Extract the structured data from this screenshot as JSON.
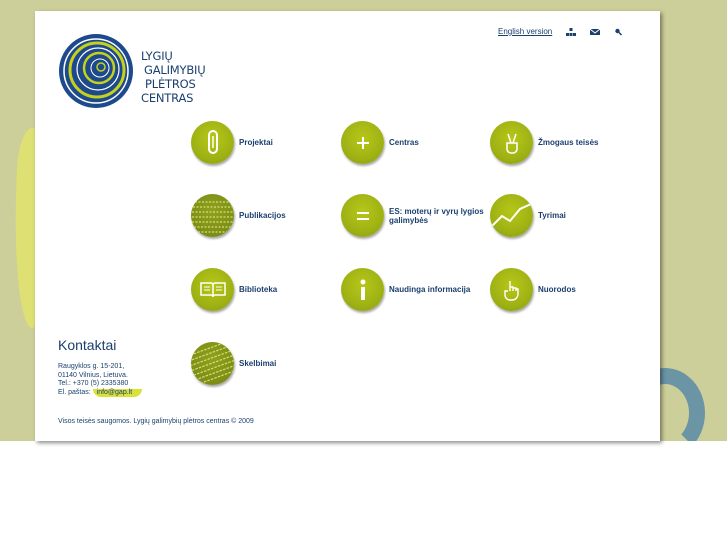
{
  "logo": {
    "lines": [
      "LYGIŲ",
      "GALIMYBIŲ",
      "PLĖTROS",
      "CENTRAS"
    ]
  },
  "topnav": {
    "english_link": "English version",
    "icons": [
      "sitemap-icon",
      "mail-icon",
      "search-icon"
    ]
  },
  "tiles": [
    {
      "label": "Projektai",
      "icon": "pencil-icon"
    },
    {
      "label": "Centras",
      "icon": "plus-icon"
    },
    {
      "label": "Žmogaus teisės",
      "icon": "victory-hand-icon"
    },
    {
      "label": "Publikacijos",
      "icon": "text-texture-icon"
    },
    {
      "label": "ES: moterų ir vyrų lygios galimybės",
      "icon": "equals-icon"
    },
    {
      "label": "Tyrimai",
      "icon": "line-chart-icon"
    },
    {
      "label": "Biblioteka",
      "icon": "open-book-icon"
    },
    {
      "label": "Naudinga informacija",
      "icon": "info-icon"
    },
    {
      "label": "Nuorodos",
      "icon": "pointing-hand-icon"
    },
    {
      "label": "Skelbimai",
      "icon": "text-texture-icon"
    }
  ],
  "contacts": {
    "title": "Kontaktai",
    "address1": "Raugyklos g. 15-201,",
    "address2": "01140 Vilnius, Lietuva.",
    "phone": "Tel.: +370 (5) 2335380",
    "email_label": "El. paštas:",
    "email": "info@gap.lt"
  },
  "footer": "Visos teisės saugomos. Lygių galimybių plėtros centras © 2009",
  "colors": {
    "background": "#cdcf9a",
    "accent": "#a6b816",
    "text": "#1b3f6e"
  }
}
